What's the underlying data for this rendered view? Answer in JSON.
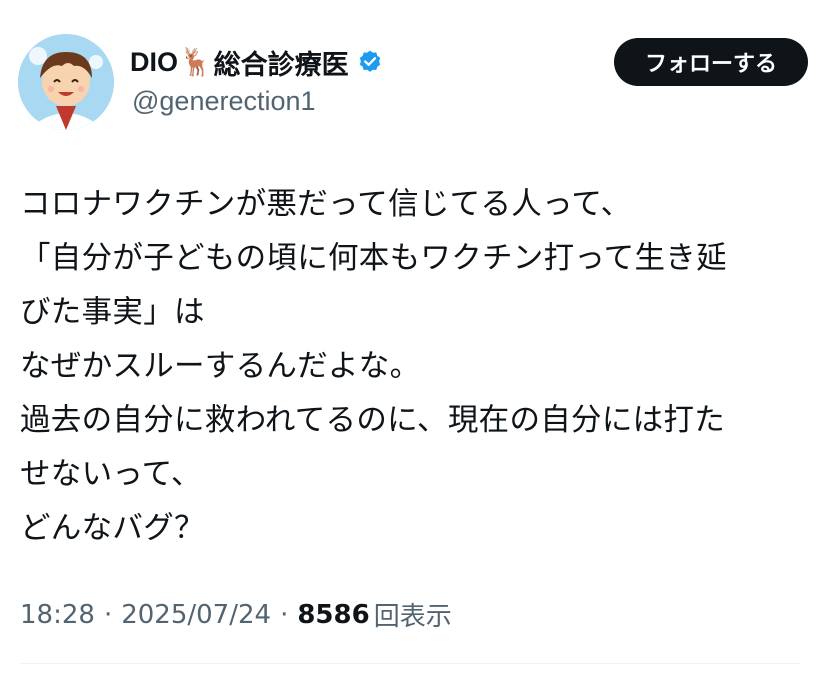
{
  "tweet": {
    "author": {
      "display_name": "DIO",
      "name_emoji": "🦌",
      "display_name_suffix": "総合診療医",
      "handle": "@generection1",
      "verified": true,
      "avatar_icon": "cartoon-doctor-avatar"
    },
    "follow_button_label": "フォローする",
    "text_lines": [
      "コロナワクチンが悪だって信じてる人って、",
      "「自分が子どもの頃に何本もワクチン打って生き延",
      "びた事実」は",
      "なぜかスルーするんだよな。",
      "過去の自分に救われてるのに、現在の自分には打た",
      "せないって、",
      "どんなバグ？"
    ],
    "meta": {
      "time": "18:28",
      "separator": "·",
      "date": "2025/07/24",
      "views_count": "8586",
      "views_label": "回表示"
    }
  },
  "colors": {
    "text_primary": "#0f1419",
    "text_secondary": "#536471",
    "verified_badge": "#1d9bf0",
    "button_bg": "#0f1419",
    "button_text": "#ffffff"
  }
}
